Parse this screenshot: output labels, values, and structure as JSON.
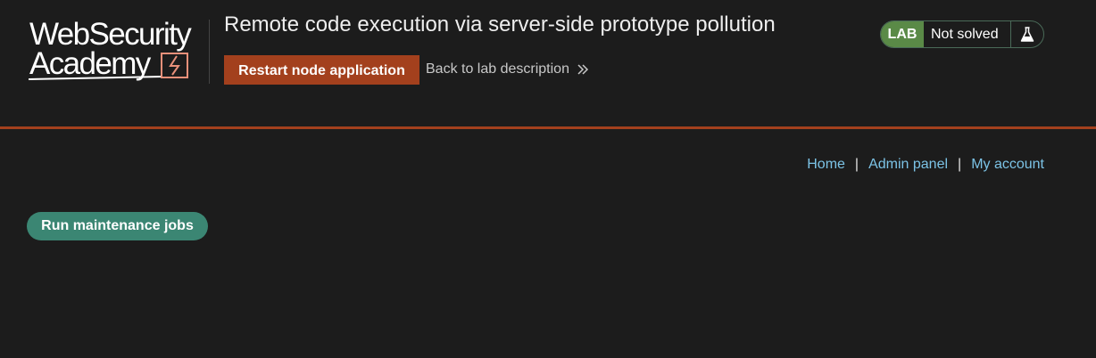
{
  "brand": {
    "logo_line1": "WebSecurity",
    "logo_line2": "Academy"
  },
  "lab": {
    "title": "Remote code execution via server-side prototype pollution",
    "restart_label": "Restart node application",
    "back_label": "Back to lab description",
    "badge": "LAB",
    "status": "Not solved"
  },
  "nav": {
    "home": "Home",
    "admin": "Admin panel",
    "account": "My account",
    "separator": "|"
  },
  "main": {
    "run_label": "Run maintenance jobs"
  },
  "colors": {
    "background": "#1c1c1c",
    "accent_orange": "#a3401d",
    "link_blue": "#7cc3e6",
    "button_green": "#3b8673",
    "badge_green": "#5a8a47"
  },
  "icons": {
    "logo_mark": "lightning-bolt-icon",
    "back_chevron": "double-chevron-right-icon",
    "status": "flask-icon"
  }
}
